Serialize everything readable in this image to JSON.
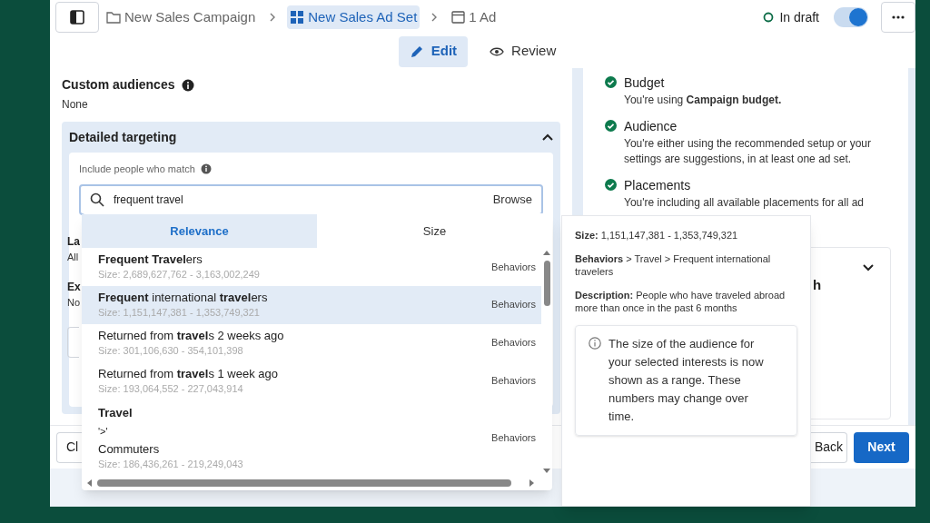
{
  "header": {
    "breadcrumbs": [
      {
        "label": "New Sales Campaign",
        "selected": false
      },
      {
        "label": "New Sales Ad Set",
        "selected": true
      },
      {
        "label": "1 Ad",
        "selected": false
      }
    ],
    "status": "In draft",
    "toggle_on": true
  },
  "mode_tabs": [
    {
      "label": "Edit",
      "selected": true
    },
    {
      "label": "Review",
      "selected": false
    }
  ],
  "left": {
    "custom_audiences": {
      "title": "Custom audiences",
      "value": "None"
    },
    "detailed_targeting": {
      "title": "Detailed targeting",
      "expanded": true,
      "include_label": "Include people who match",
      "search_value": "frequent travel",
      "browse": "Browse"
    },
    "clipped_fields": [
      {
        "label": "La",
        "value": "All"
      },
      {
        "label": "Ex",
        "value": "No"
      }
    ]
  },
  "right": {
    "checklist": [
      {
        "title": "Budget",
        "description": "You're using **Campaign budget.**"
      },
      {
        "title": "Audience",
        "description": "You're either using the recommended setup or your settings are suggestions, in at least one ad set."
      },
      {
        "title": "Placements",
        "description": "You're including all available placements for all ad"
      }
    ],
    "card_fragment": "h"
  },
  "dropdown": {
    "sort_tabs": [
      {
        "label": "Relevance",
        "selected": true
      },
      {
        "label": "Size",
        "selected": false
      }
    ],
    "results": [
      {
        "kind": "item",
        "name": "**Frequent Travel**ers",
        "size": "Size: 2,689,627,762 - 3,163,002,249",
        "category": "Behaviors",
        "selected": false
      },
      {
        "kind": "item",
        "name": "**Frequent** international **travel**ers",
        "size": "Size: 1,151,147,381 - 1,353,749,321",
        "category": "Behaviors",
        "selected": true
      },
      {
        "kind": "item",
        "name": "Returned from **travel**s 2 weeks ago",
        "size": "Size: 301,106,630 - 354,101,398",
        "category": "Behaviors",
        "selected": false
      },
      {
        "kind": "item",
        "name": "Returned from **travel**s 1 week ago",
        "size": "Size: 193,064,552 - 227,043,914",
        "category": "Behaviors",
        "selected": false
      },
      {
        "kind": "path",
        "heading": "Travel",
        "separator": "'>'",
        "name": "Commuters",
        "size": "Size: 186,436,261 - 219,249,043",
        "category": "Behaviors",
        "selected": false
      }
    ]
  },
  "tooltip": {
    "size": "**Size:** 1,151,147,381 - 1,353,749,321",
    "path": "**Behaviors** > Travel > Frequent international travelers",
    "description": "**Description:** People who have traveled abroad more than once in the past 6 months",
    "notice": "The size of the audience for your selected interests is now shown as a range. These numbers may change over time."
  },
  "footer": {
    "left_button": "Cl",
    "back": "Back",
    "next": "Next"
  }
}
